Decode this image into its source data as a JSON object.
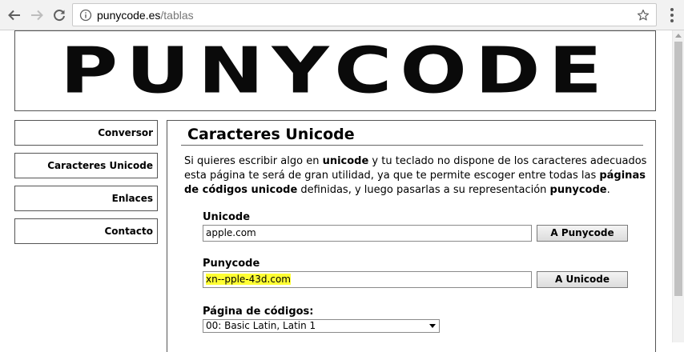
{
  "browser": {
    "url_host": "punycode.es",
    "url_path": "/tablas"
  },
  "header": {
    "logo_text": "PUNYCODE"
  },
  "sidebar": {
    "items": [
      {
        "label": "Conversor"
      },
      {
        "label": "Caracteres Unicode"
      },
      {
        "label": "Enlaces"
      },
      {
        "label": "Contacto"
      }
    ]
  },
  "main": {
    "title": "Caracteres Unicode",
    "intro": {
      "t1": "Si quieres escribir algo en ",
      "b1": "unicode",
      "t2": " y tu teclado no dispone de los caracteres adecuados esta página te será de gran utilidad, ya que te permite escoger entre todas las ",
      "b2": "páginas de códigos unicode",
      "t3": " definidas, y luego pasarlas a su representación ",
      "b3": "punycode",
      "t4": "."
    },
    "unicode": {
      "label": "Unicode",
      "value": "apple.com",
      "button": "A Punycode"
    },
    "punycode": {
      "label": "Punycode",
      "value": "xn--pple-43d.com",
      "button": "A Unicode"
    },
    "codepage": {
      "label": "Página de códigos:",
      "selected": "00: Basic Latin, Latin 1"
    }
  },
  "colors": {
    "highlight": "#ffff33",
    "border": "#555555"
  }
}
